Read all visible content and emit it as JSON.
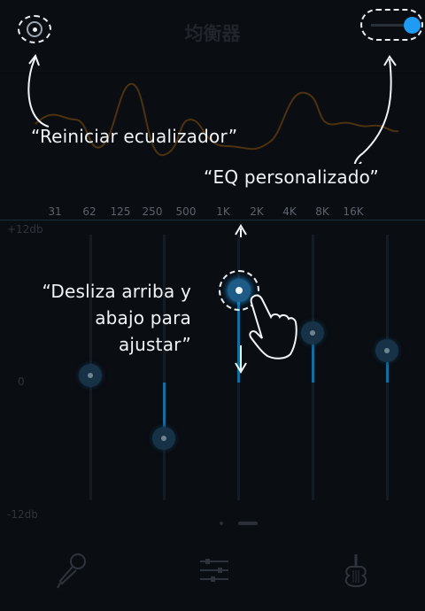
{
  "header": {
    "title": "均衡器"
  },
  "frequency_axis": {
    "labels": [
      "31",
      "62",
      "125",
      "250",
      "500",
      "1K",
      "2K",
      "4K",
      "8K",
      "16K"
    ]
  },
  "gain_scale": {
    "top": "+12db",
    "middle": "0",
    "bottom": "-12db"
  },
  "tutorial": {
    "reset_hint": "“Reiniciar ecualizador”",
    "custom_hint": "“EQ personalizado”",
    "slide_hint_line1": "“Desliza arriba y",
    "slide_hint_line2": "abajo para ajustar”"
  },
  "bands": [
    {
      "frequency": "62",
      "gain_db": 0.6
    },
    {
      "frequency": "250",
      "gain_db": -4.5
    },
    {
      "frequency": "1K",
      "gain_db": 7.2
    },
    {
      "frequency": "4K",
      "gain_db": 4.0
    },
    {
      "frequency": "16K",
      "gain_db": 2.6
    }
  ],
  "tabs": [
    {
      "icon": "microphone-icon"
    },
    {
      "icon": "equalizer-sliders-icon"
    },
    {
      "icon": "guitar-icon"
    }
  ],
  "colors": {
    "accent": "#1e9bf2",
    "background": "#0a0d12",
    "curve": "#5a3a10"
  }
}
